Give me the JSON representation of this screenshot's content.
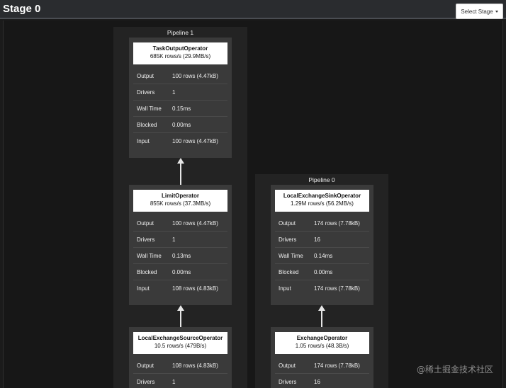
{
  "header": {
    "title": "Stage 0",
    "select_stage_label": "Select Stage"
  },
  "pipelines": {
    "p1": {
      "label": "Pipeline 1",
      "ops": [
        {
          "name": "TaskOutputOperator",
          "rate": "685K rows/s (29.9MB/s)",
          "rows": [
            {
              "k": "Output",
              "v": "100 rows (4.47kB)"
            },
            {
              "k": "Drivers",
              "v": "1"
            },
            {
              "k": "Wall Time",
              "v": "0.15ms"
            },
            {
              "k": "Blocked",
              "v": "0.00ms"
            },
            {
              "k": "Input",
              "v": "100 rows (4.47kB)"
            }
          ]
        },
        {
          "name": "LimitOperator",
          "rate": "855K rows/s (37.3MB/s)",
          "rows": [
            {
              "k": "Output",
              "v": "100 rows (4.47kB)"
            },
            {
              "k": "Drivers",
              "v": "1"
            },
            {
              "k": "Wall Time",
              "v": "0.13ms"
            },
            {
              "k": "Blocked",
              "v": "0.00ms"
            },
            {
              "k": "Input",
              "v": "108 rows (4.83kB)"
            }
          ]
        },
        {
          "name": "LocalExchangeSourceOperator",
          "rate": "10.5 rows/s (479B/s)",
          "rows": [
            {
              "k": "Output",
              "v": "108 rows (4.83kB)"
            },
            {
              "k": "Drivers",
              "v": "1"
            }
          ]
        }
      ]
    },
    "p0": {
      "label": "Pipeline 0",
      "ops": [
        {
          "name": "LocalExchangeSinkOperator",
          "rate": "1.29M rows/s (56.2MB/s)",
          "rows": [
            {
              "k": "Output",
              "v": "174 rows (7.78kB)"
            },
            {
              "k": "Drivers",
              "v": "16"
            },
            {
              "k": "Wall Time",
              "v": "0.14ms"
            },
            {
              "k": "Blocked",
              "v": "0.00ms"
            },
            {
              "k": "Input",
              "v": "174 rows (7.78kB)"
            }
          ]
        },
        {
          "name": "ExchangeOperator",
          "rate": "1.05 rows/s (48.3B/s)",
          "rows": [
            {
              "k": "Output",
              "v": "174 rows (7.78kB)"
            },
            {
              "k": "Drivers",
              "v": "16"
            }
          ]
        }
      ]
    }
  },
  "watermark": "@稀土掘金技术社区"
}
